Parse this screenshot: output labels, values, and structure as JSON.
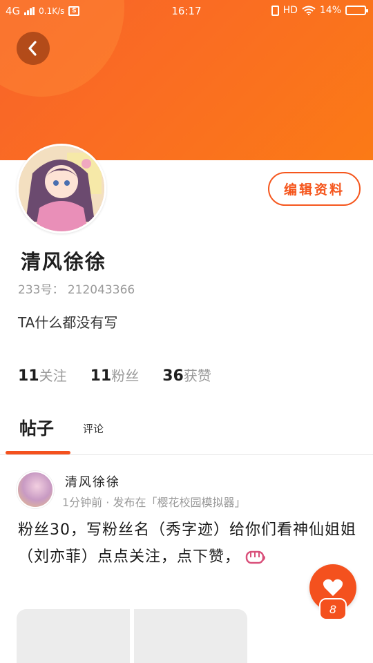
{
  "status_bar": {
    "network": "4G",
    "speed": "0.1K/s",
    "time": "16:17",
    "hd": "HD",
    "battery_percent": "14%",
    "battery_level": 0.14
  },
  "header": {
    "back_icon": "back-arrow-icon",
    "accent_color": "#f5561d"
  },
  "profile": {
    "name": "清风徐徐",
    "id_text": "233号： 212043366",
    "bio": "TA什么都没有写",
    "edit_label": "编辑资料"
  },
  "stats": [
    {
      "num": "11",
      "label": "关注"
    },
    {
      "num": "11",
      "label": "粉丝"
    },
    {
      "num": "36",
      "label": "获赞"
    }
  ],
  "tabs": {
    "posts": "帖子",
    "comments": "评论"
  },
  "post": {
    "author": "清风徐徐",
    "meta": "1分钟前 · 发布在「樱花校园模拟器」",
    "body": "粉丝30，写粉丝名（秀字迹）给你们看神仙姐姐（刘亦菲）点点关注，点下赞，",
    "emoji_icon": "fist-icon"
  },
  "like": {
    "count": "8",
    "icon": "heart-icon"
  }
}
